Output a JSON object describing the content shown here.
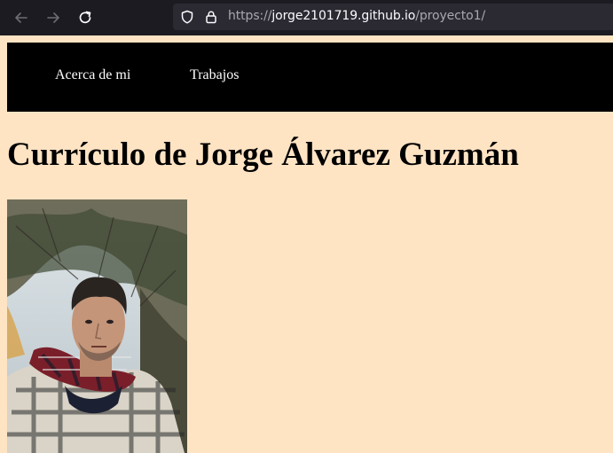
{
  "browser": {
    "url_scheme": "https://",
    "url_host": "jorge2101719.github.io",
    "url_path": "/proyecto1/",
    "icons": [
      "back-arrow-icon",
      "forward-arrow-icon",
      "reload-icon",
      "shield-icon",
      "lock-icon"
    ]
  },
  "nav": {
    "items": [
      {
        "label": "Acerca de mi"
      },
      {
        "label": "Trabajos"
      }
    ]
  },
  "page": {
    "title": "Currículo de Jorge Álvarez Guzmán"
  },
  "colors": {
    "page_background": "#ffe4c4",
    "nav_background": "#000000",
    "chrome_background": "#1c1b22",
    "url_bar_background": "#2b2a33"
  }
}
